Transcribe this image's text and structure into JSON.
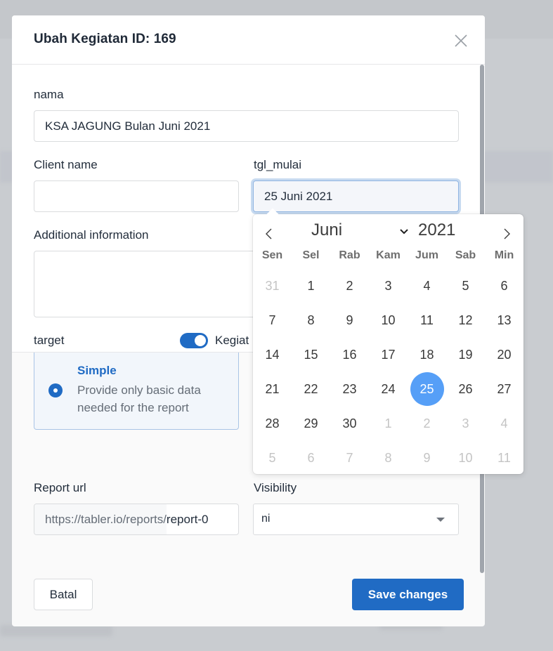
{
  "modal": {
    "title": "Ubah Kegiatan ID: 169",
    "close_icon": "close-icon"
  },
  "form": {
    "nama": {
      "label": "nama",
      "value": "KSA JAGUNG Bulan Juni 2021"
    },
    "client_name": {
      "label": "Client name",
      "value": ""
    },
    "tgl_mulai": {
      "label": "tgl_mulai",
      "value": "25 Juni 2021"
    },
    "additional_info": {
      "label": "Additional information",
      "value": ""
    },
    "target": {
      "label": "target",
      "toggle_label": "Kegiat",
      "toggle_on": true
    },
    "report_type_option": {
      "title": "Simple",
      "description": "Provide only basic data needed for the report",
      "selected": true
    },
    "report_url": {
      "label": "Report url",
      "prefix": "https://tabler.io/reports/",
      "value": "report-0"
    },
    "visibility": {
      "label": "Visibility",
      "value": "ni"
    }
  },
  "footer": {
    "cancel_label": "Batal",
    "save_label": "Save changes"
  },
  "datepicker": {
    "month": "Juni",
    "year": "2021",
    "weekdays": [
      "Sen",
      "Sel",
      "Rab",
      "Kam",
      "Jum",
      "Sab",
      "Min"
    ],
    "selected_day": 25,
    "weeks": [
      [
        {
          "d": "31",
          "m": true
        },
        {
          "d": "1"
        },
        {
          "d": "2"
        },
        {
          "d": "3"
        },
        {
          "d": "4"
        },
        {
          "d": "5"
        },
        {
          "d": "6"
        }
      ],
      [
        {
          "d": "7"
        },
        {
          "d": "8"
        },
        {
          "d": "9"
        },
        {
          "d": "10"
        },
        {
          "d": "11"
        },
        {
          "d": "12"
        },
        {
          "d": "13"
        }
      ],
      [
        {
          "d": "14"
        },
        {
          "d": "15"
        },
        {
          "d": "16"
        },
        {
          "d": "17"
        },
        {
          "d": "18"
        },
        {
          "d": "19"
        },
        {
          "d": "20"
        }
      ],
      [
        {
          "d": "21"
        },
        {
          "d": "22"
        },
        {
          "d": "23"
        },
        {
          "d": "24"
        },
        {
          "d": "25",
          "s": true
        },
        {
          "d": "26"
        },
        {
          "d": "27"
        }
      ],
      [
        {
          "d": "28"
        },
        {
          "d": "29"
        },
        {
          "d": "30"
        },
        {
          "d": "1",
          "m": true
        },
        {
          "d": "2",
          "m": true
        },
        {
          "d": "3",
          "m": true
        },
        {
          "d": "4",
          "m": true
        }
      ],
      [
        {
          "d": "5",
          "m": true
        },
        {
          "d": "6",
          "m": true
        },
        {
          "d": "7",
          "m": true
        },
        {
          "d": "8",
          "m": true
        },
        {
          "d": "9",
          "m": true
        },
        {
          "d": "10",
          "m": true
        },
        {
          "d": "11",
          "m": true
        }
      ]
    ]
  },
  "colors": {
    "primary": "#206bc4",
    "selected_day": "#569ff7",
    "overlay": "#c9ccd0"
  }
}
